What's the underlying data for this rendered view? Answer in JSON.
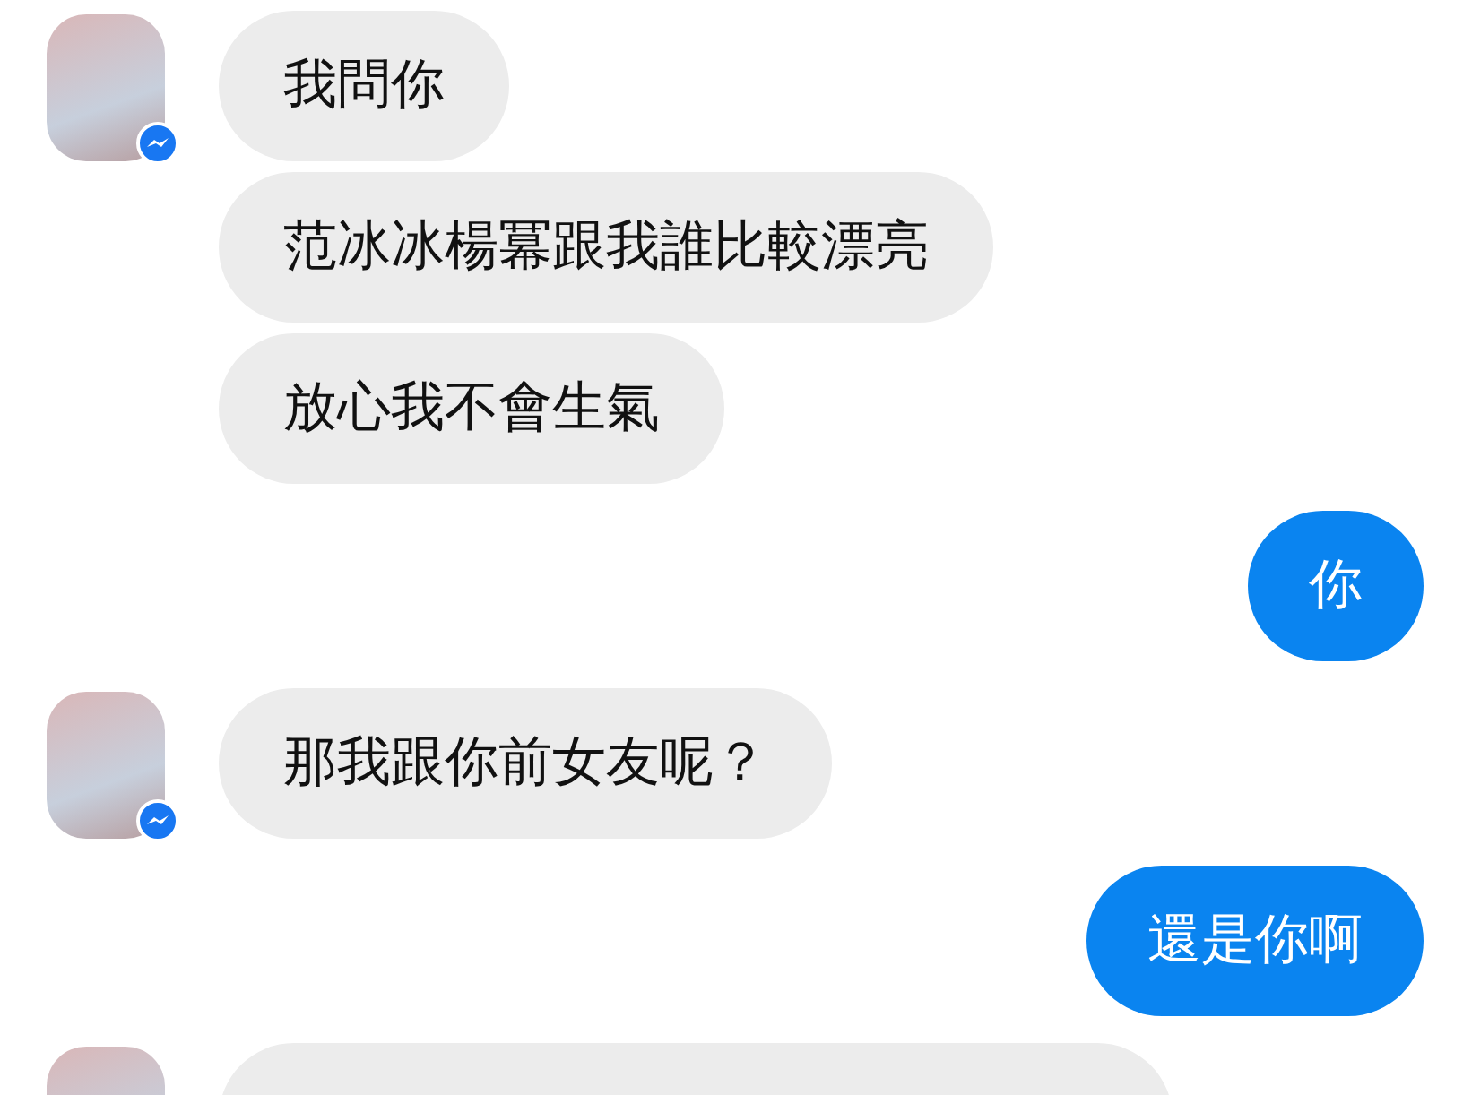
{
  "conversation": [
    {
      "kind": "received",
      "messages": [
        {
          "kind": "text",
          "text": "我問你"
        },
        {
          "kind": "text",
          "text": "范冰冰楊冪跟我誰比較漂亮"
        },
        {
          "kind": "text",
          "text": "放心我不會生氣"
        }
      ]
    },
    {
      "kind": "sent",
      "messages": [
        {
          "kind": "text",
          "text": "你"
        }
      ]
    },
    {
      "kind": "received",
      "messages": [
        {
          "kind": "text",
          "text": "那我跟你前女友呢？"
        }
      ]
    },
    {
      "kind": "sent",
      "messages": [
        {
          "kind": "text",
          "text": "還是你啊"
        }
      ]
    },
    {
      "kind": "received",
      "messages": [
        {
          "kind": "clipped"
        }
      ]
    }
  ]
}
